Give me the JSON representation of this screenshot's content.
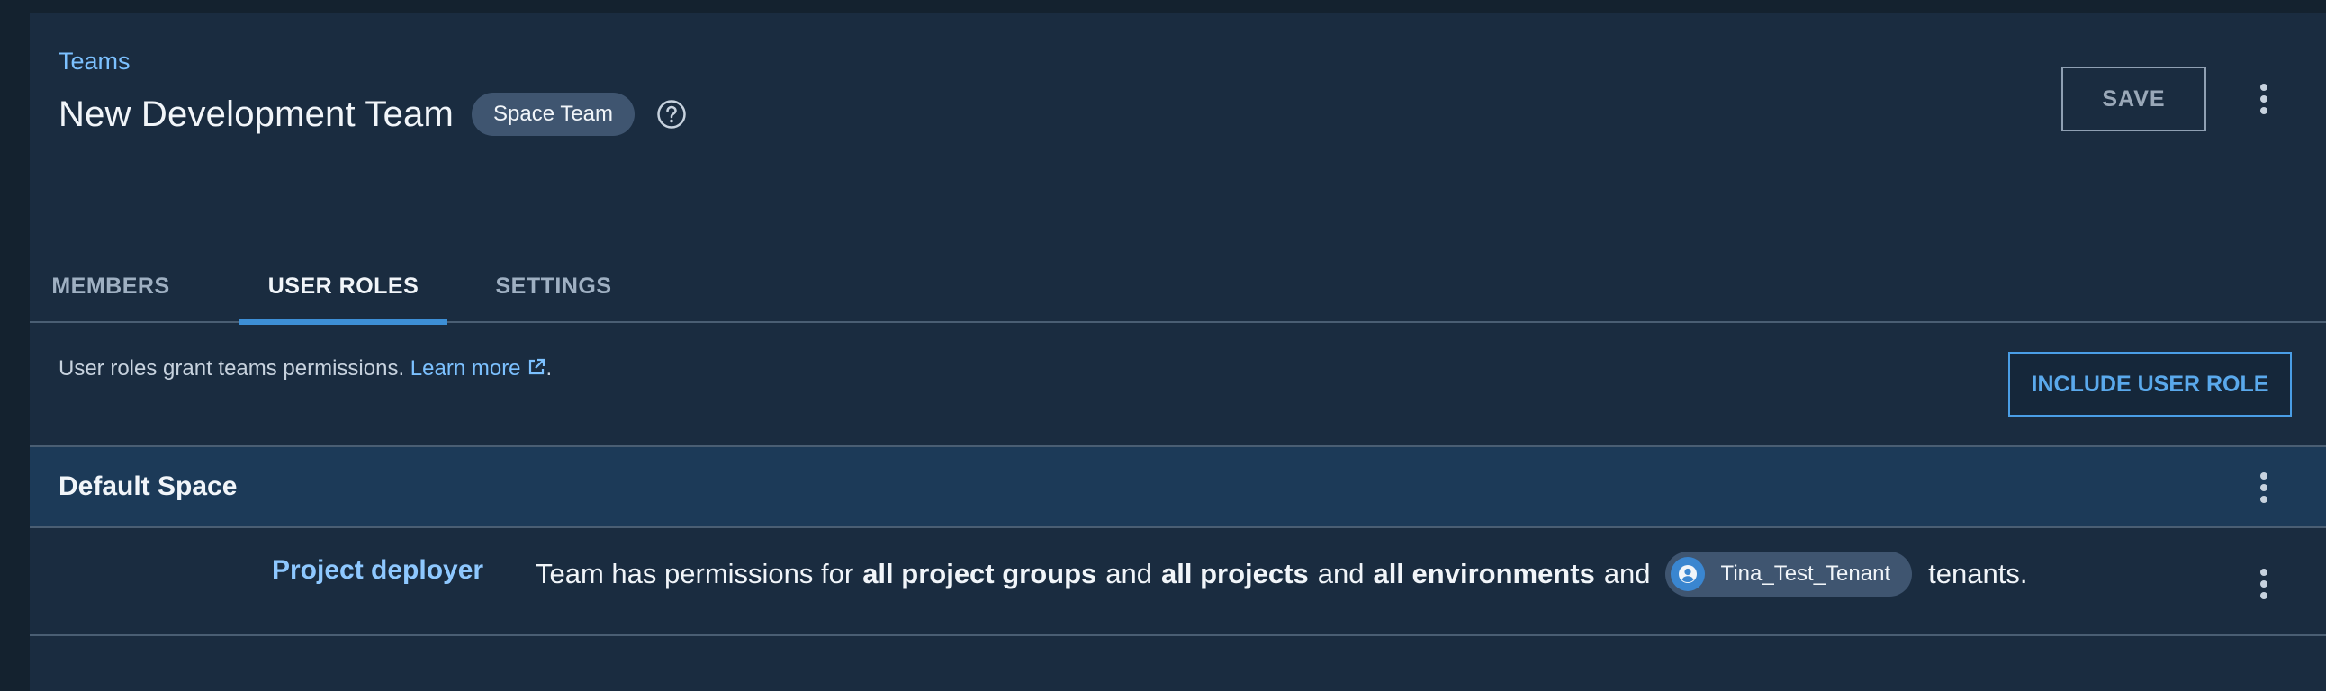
{
  "header": {
    "breadcrumb": "Teams",
    "title": "New Development Team",
    "badge": "Space Team",
    "save_label": "SAVE"
  },
  "tabs": [
    {
      "label": "MEMBERS",
      "active": false
    },
    {
      "label": "USER ROLES",
      "active": true
    },
    {
      "label": "SETTINGS",
      "active": false
    }
  ],
  "info": {
    "text": "User roles grant teams permissions. ",
    "link": "Learn more",
    "suffix": ".",
    "include_button": "INCLUDE USER ROLE"
  },
  "section": {
    "title": "Default Space"
  },
  "role": {
    "name": "Project deployer",
    "desc_1": "Team has permissions for",
    "bold_1": "all project groups",
    "and_1": "and",
    "bold_2": "all projects",
    "and_2": "and",
    "bold_3": "all environments",
    "and_3": "and",
    "tenant": "Tina_Test_Tenant",
    "desc_end": "tenants."
  },
  "colors": {
    "background": "#1a2c40",
    "accent": "#3d8fd6",
    "link": "#7cc1ff",
    "section_header": "#1c3a58"
  },
  "icons": [
    "help-icon",
    "kebab-menu-icon",
    "external-link-icon",
    "tenant-avatar-icon"
  ]
}
